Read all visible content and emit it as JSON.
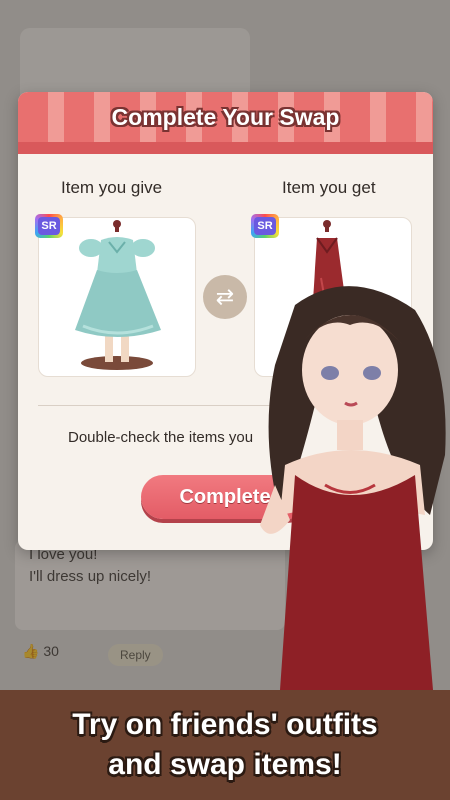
{
  "background": {
    "post_text_1": "I love you!",
    "post_text_2": "I'll dress up nicely!",
    "like_count": "30",
    "reply_label": "Reply"
  },
  "dialog": {
    "title": "Complete Your Swap",
    "give_label": "Item you give",
    "get_label": "Item you get",
    "give_rarity": "SR",
    "get_rarity": "SR",
    "note": "Double-check the items you",
    "complete_button": "Complete",
    "icons": [
      "swap-arrows-icon",
      "rarity-badge-icon"
    ]
  },
  "banner": {
    "line1": "Try on friends' outfits",
    "line2": "and swap items!"
  },
  "colors": {
    "header_pink": "#e8706f",
    "button_pink": "#e35c66",
    "banner_brown": "#6b4230",
    "dialog_bg": "#f7f2ec"
  }
}
